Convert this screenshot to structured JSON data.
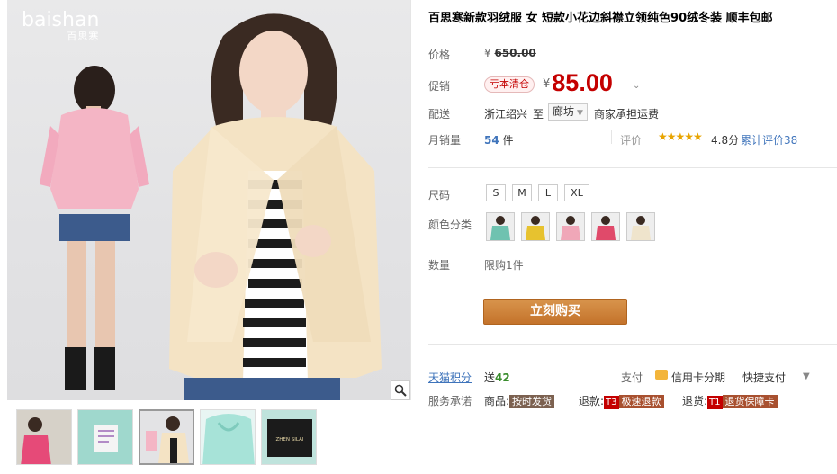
{
  "brand": {
    "name_en": "baishan",
    "name_cn": "百思寒"
  },
  "product": {
    "title": "百思寒新款羽绒服 女 短款小花边斜襟立领纯色90绒冬装 顺丰包邮"
  },
  "price": {
    "label": "价格",
    "currency": "¥",
    "original": "650.00"
  },
  "promo": {
    "label": "促销",
    "tag": "亏本清仓",
    "currency": "¥",
    "price": "85.00"
  },
  "shipping": {
    "label": "配送",
    "from": "浙江绍兴",
    "to_word": "至",
    "destination": "廊坊",
    "fee_note": "商家承担运费"
  },
  "sales": {
    "label": "月销量",
    "count": "54",
    "unit": "件",
    "rating_label": "评价",
    "stars": "★★★★★",
    "score": "4.8分",
    "reviews": "累计评价38"
  },
  "size": {
    "label": "尺码",
    "options": [
      "S",
      "M",
      "L",
      "XL"
    ]
  },
  "color": {
    "label": "颜色分类",
    "swatches": [
      "#6fc2b0",
      "#e7c22f",
      "#f0a7b8",
      "#e04a6a",
      "#efe4cc"
    ]
  },
  "quantity": {
    "label": "数量",
    "limit": "限购1件"
  },
  "buy_button": "立刻购买",
  "points": {
    "label": "天猫积分",
    "prefix": "送",
    "value": "42"
  },
  "payment": {
    "label": "支付",
    "card": "信用卡分期",
    "quick": "快捷支付"
  },
  "service": {
    "label": "服务承诺",
    "goods_prefix": "商品:",
    "goods_tag": "按时发货",
    "refund_prefix": "退款:",
    "refund_code": "T3",
    "refund_tag": "极速退款",
    "return_prefix": "退货:",
    "return_code": "T1",
    "return_tag": "退货保障卡"
  },
  "thumbnails": [
    {
      "icon": "thumb-pink-jacket"
    },
    {
      "icon": "thumb-label-closeup"
    },
    {
      "icon": "thumb-cream-jacket"
    },
    {
      "icon": "thumb-mint-collar"
    },
    {
      "icon": "thumb-brand-tag",
      "text": "ZHEN SILAI"
    }
  ],
  "colors": {
    "price_red": "#c40000",
    "link_blue": "#3f74bb",
    "buy_orange": "#d0823c"
  }
}
